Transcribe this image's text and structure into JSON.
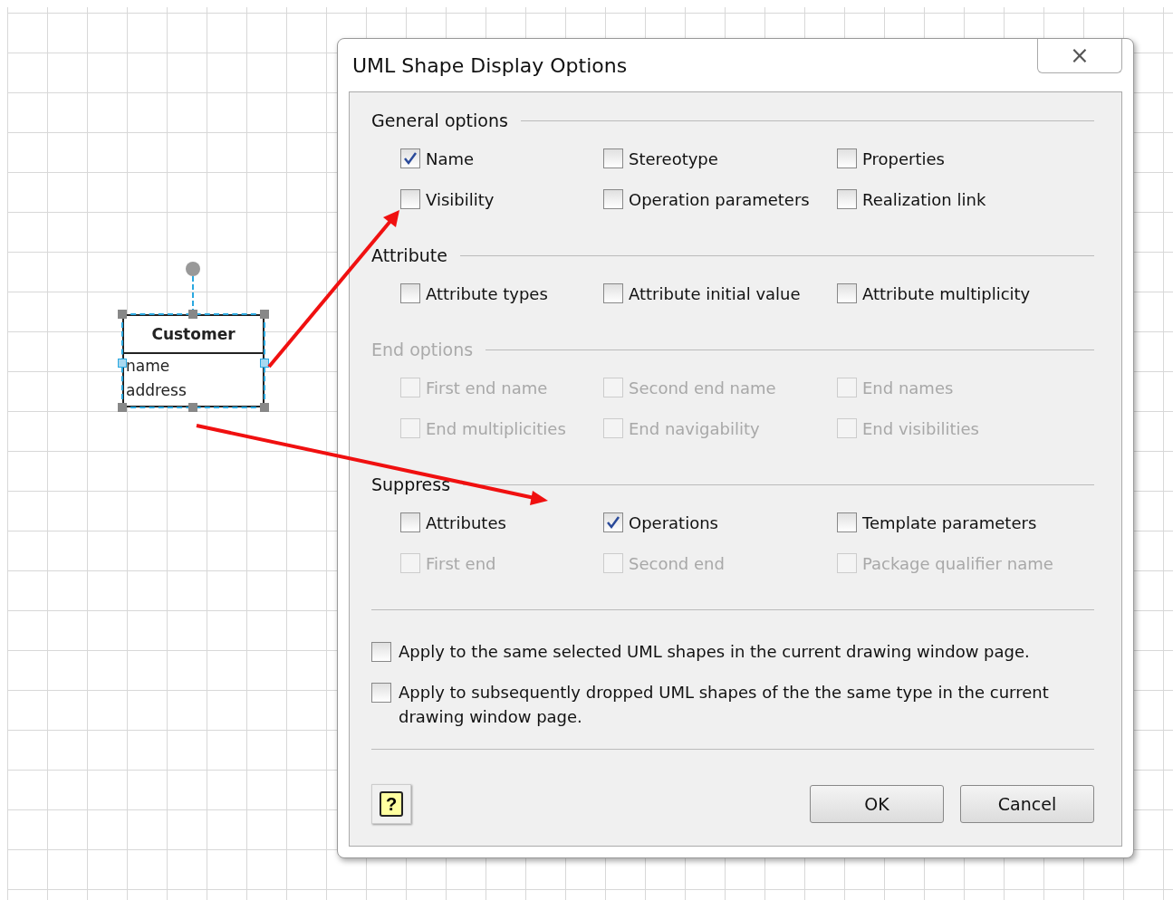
{
  "shape": {
    "title": "Customer",
    "attributes": [
      "name",
      "address"
    ],
    "selected": true
  },
  "dialog": {
    "title": "UML Shape Display Options",
    "close_label": "⨯",
    "sections": [
      {
        "title": "General options",
        "disabled": false,
        "items": [
          {
            "label": "Name",
            "checked": true,
            "disabled": false
          },
          {
            "label": "Stereotype",
            "checked": false,
            "disabled": false
          },
          {
            "label": "Properties",
            "checked": false,
            "disabled": false
          },
          {
            "label": "Visibility",
            "checked": false,
            "disabled": false
          },
          {
            "label": "Operation parameters",
            "checked": false,
            "disabled": false
          },
          {
            "label": "Realization link",
            "checked": false,
            "disabled": false
          }
        ]
      },
      {
        "title": "Attribute",
        "disabled": false,
        "items": [
          {
            "label": "Attribute types",
            "checked": false,
            "disabled": false
          },
          {
            "label": "Attribute initial value",
            "checked": false,
            "disabled": false
          },
          {
            "label": "Attribute multiplicity",
            "checked": false,
            "disabled": false
          }
        ]
      },
      {
        "title": "End options",
        "disabled": true,
        "items": [
          {
            "label": "First end name",
            "checked": false,
            "disabled": true
          },
          {
            "label": "Second end name",
            "checked": false,
            "disabled": true
          },
          {
            "label": "End names",
            "checked": false,
            "disabled": true
          },
          {
            "label": "End multiplicities",
            "checked": false,
            "disabled": true
          },
          {
            "label": "End navigability",
            "checked": false,
            "disabled": true
          },
          {
            "label": "End visibilities",
            "checked": false,
            "disabled": true
          }
        ]
      },
      {
        "title": "Suppress",
        "disabled": false,
        "items": [
          {
            "label": "Attributes",
            "checked": false,
            "disabled": false
          },
          {
            "label": "Operations",
            "checked": true,
            "disabled": false
          },
          {
            "label": "Template parameters",
            "checked": false,
            "disabled": false
          },
          {
            "label": "First end",
            "checked": false,
            "disabled": true
          },
          {
            "label": "Second end",
            "checked": false,
            "disabled": true
          },
          {
            "label": "Package qualifier name",
            "checked": false,
            "disabled": true
          }
        ]
      }
    ],
    "apply_options": [
      {
        "label": "Apply to the same selected UML shapes in the current drawing window page.",
        "checked": false
      },
      {
        "label": "Apply to subsequently dropped UML shapes of the the same type in the current drawing window page.",
        "checked": false
      }
    ],
    "help_button": "?",
    "buttons": [
      "OK",
      "Cancel"
    ]
  }
}
